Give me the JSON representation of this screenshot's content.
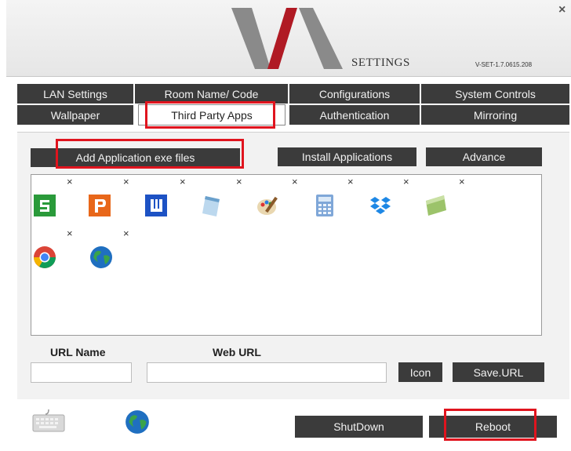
{
  "header": {
    "logo_text": "VIA",
    "title": "SETTINGS",
    "version": "V-SET-1.7.0615.208",
    "close": "×"
  },
  "tabs_row1": [
    "LAN Settings",
    "Room Name/ Code",
    "Configurations",
    "System Controls"
  ],
  "tabs_row2": [
    "Wallpaper",
    "Third Party Apps",
    "Authentication",
    "Mirroring"
  ],
  "active_tab": "Third Party Apps",
  "toolbar": {
    "add_app": "Add Application exe files",
    "install": "Install Applications",
    "advance": "Advance"
  },
  "apps": {
    "remove_glyph": "×",
    "icons": [
      "spreadsheet-app-icon",
      "presentation-app-icon",
      "writer-app-icon",
      "notepad-icon",
      "paint-icon",
      "calculator-icon",
      "dropbox-icon",
      "notes-icon",
      "chrome-icon",
      "globe-icon"
    ]
  },
  "url_form": {
    "url_name_label": "URL Name",
    "web_url_label": "Web URL",
    "url_name_value": "",
    "web_url_value": "",
    "icon_button": "Icon",
    "save_button": "Save.URL"
  },
  "footer": {
    "shutdown": "ShutDown",
    "reboot": "Reboot"
  },
  "colors": {
    "highlight": "#e0141e",
    "tab_bg": "#3b3b3b",
    "logo_red": "#b01a24",
    "logo_gray": "#8a8a8a"
  }
}
